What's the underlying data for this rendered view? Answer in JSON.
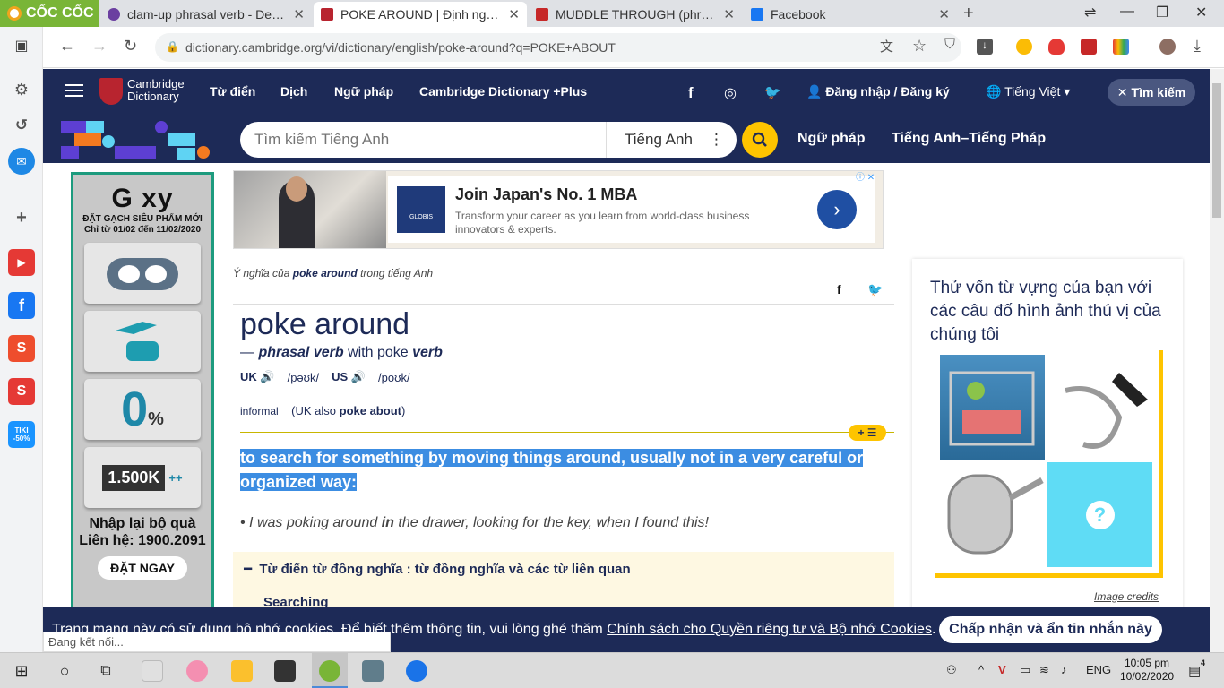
{
  "browser": {
    "brand": "CỐC CỐC",
    "tabs": [
      {
        "title": "clam-up phrasal verb - Defini",
        "color": "#6b3fa0"
      },
      {
        "title": "POKE AROUND | Định nghĩa t",
        "color": "#b8242f"
      },
      {
        "title": "MUDDLE THROUGH (phrasal",
        "color": "#c62828"
      },
      {
        "title": "Facebook",
        "color": "#1877f2"
      }
    ],
    "url": "dictionary.cambridge.org/vi/dictionary/english/poke-around?q=POKE+ABOUT",
    "status_text": "Đang kết nối..."
  },
  "sidebar_apps": [
    {
      "name": "youtube",
      "color": "#e53935",
      "glyph": "▶"
    },
    {
      "name": "facebook",
      "color": "#1877f2",
      "glyph": "f"
    },
    {
      "name": "shopee",
      "color": "#ee4d2d",
      "glyph": "S"
    },
    {
      "name": "sendo",
      "color": "#e53935",
      "glyph": "S"
    },
    {
      "name": "tiki",
      "color": "#1a94ff",
      "glyph": "TIKI -50%"
    }
  ],
  "nav": {
    "logo_line1": "Cambridge",
    "logo_line2": "Dictionary",
    "items": [
      "Từ điển",
      "Dịch",
      "Ngữ pháp",
      "Cambridge Dictionary +Plus"
    ],
    "login": "Đăng nhập / Đăng ký",
    "language": "Tiếng Việt",
    "search_pill": "Tìm kiếm"
  },
  "search": {
    "placeholder": "Tìm kiếm Tiếng Anh",
    "language": "Tiếng Anh",
    "links": [
      "Ngữ pháp",
      "Tiếng Anh–Tiếng Pháp"
    ]
  },
  "left_ad": {
    "brand": "G  xy",
    "line1": "ĐẶT GẠCH SIÊU PHẨM MỚI",
    "line2": "Chỉ từ 01/02 đến 11/02/2020",
    "zero": "0",
    "percent": "%",
    "price": "1.500K",
    "price_suffix": "++",
    "big1": "Nhập lại bộ quà",
    "big2": "Liên hệ: 1900.2091",
    "cta": "ĐẶT NGAY"
  },
  "top_ad": {
    "logo": "GLOBIS",
    "headline": "Join Japan's No. 1 MBA",
    "desc": "Transform your career as you learn from world-class business innovators & experts."
  },
  "entry": {
    "crumb_prefix": "Ý nghĩa của",
    "crumb_word": "poke around",
    "crumb_suffix": "trong tiếng Anh",
    "headword": "poke around",
    "dash": "—",
    "pos": "phrasal verb",
    "with": "with poke",
    "verb": "verb",
    "uk": "UK",
    "uk_ipa": "/pəʊk/",
    "us": "US",
    "us_ipa": "/poʊk/",
    "label": "informal",
    "also_prefix": "(UK also",
    "also_word": "poke about",
    "also_suffix": ")",
    "definition_line1": "to search for something by moving things around, usually not in a very careful or",
    "definition_line2": "organized way:",
    "example_pre": "I was poking around",
    "example_bold": "in",
    "example_post": "the drawer, looking for the key, when I found this!",
    "thesaurus_title": "Từ điển từ đồng nghĩa : từ đồng nghĩa và các từ liên quan",
    "thesaurus_item": "Searching"
  },
  "quiz": {
    "title": "Thử vốn từ vựng của bạn với các câu đố hình ảnh thú vị của chúng tôi",
    "credits": "Image credits"
  },
  "cookie": {
    "text_pre": "Trang mạng này có sử dụng bộ nhớ cookies. Để biết thêm thông tin, vui lòng ghé thăm",
    "link": "Chính sách cho Quyền riêng tư và Bộ nhớ Cookies",
    "text_post": ".",
    "button": "Chấp nhận và ẩn tin nhắn này"
  },
  "taskbar": {
    "lang": "ENG",
    "time": "10:05 pm",
    "date": "10/02/2020",
    "notif_count": "4"
  }
}
